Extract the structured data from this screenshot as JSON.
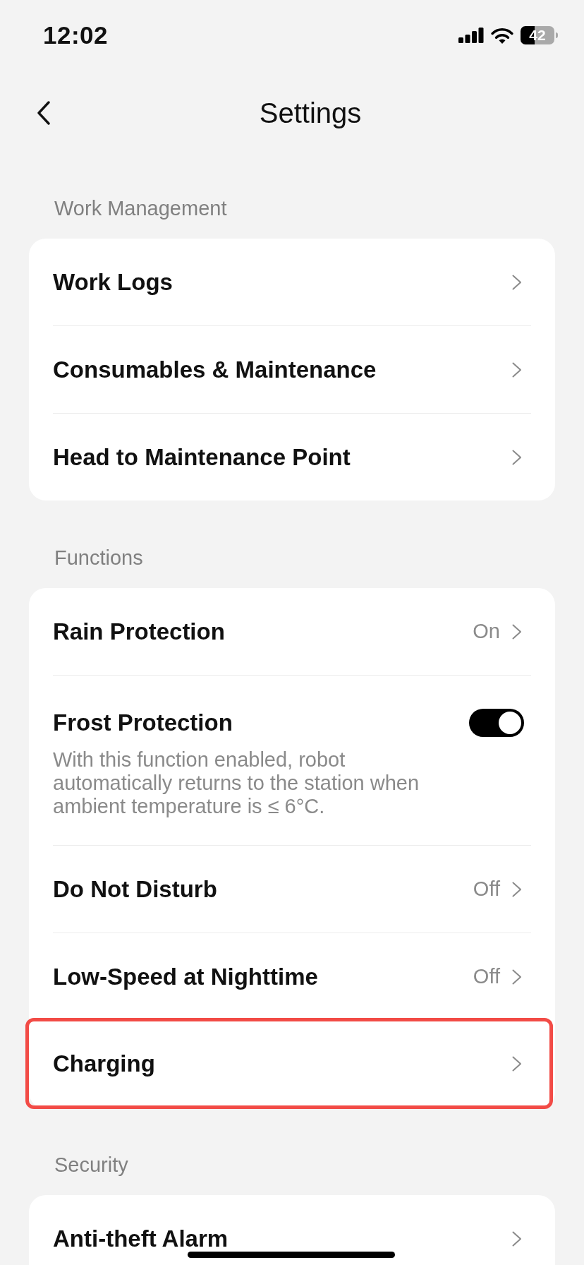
{
  "status_bar": {
    "time": "12:02",
    "battery": "42"
  },
  "header": {
    "title": "Settings"
  },
  "sections": [
    {
      "title": "Work Management",
      "items": [
        {
          "kind": "link",
          "label": "Work Logs",
          "highlighted": false
        },
        {
          "kind": "link",
          "label": "Consumables & Maintenance",
          "highlighted": false
        },
        {
          "kind": "link",
          "label": "Head to Maintenance Point",
          "highlighted": false
        }
      ]
    },
    {
      "title": "Functions",
      "items": [
        {
          "kind": "link",
          "label": "Rain Protection",
          "value": "On",
          "highlighted": false
        },
        {
          "kind": "toggle",
          "label": "Frost Protection",
          "on": true,
          "description": "With this function enabled, robot automatically returns to the station when ambient temperature is ≤ 6°C.",
          "highlighted": false
        },
        {
          "kind": "link",
          "label": "Do Not Disturb",
          "value": "Off",
          "highlighted": false
        },
        {
          "kind": "link",
          "label": "Low-Speed at Nighttime",
          "value": "Off",
          "highlighted": false
        },
        {
          "kind": "link",
          "label": "Charging",
          "highlighted": true
        }
      ]
    },
    {
      "title": "Security",
      "items": [
        {
          "kind": "link",
          "label": "Anti-theft Alarm",
          "highlighted": false
        }
      ]
    }
  ]
}
